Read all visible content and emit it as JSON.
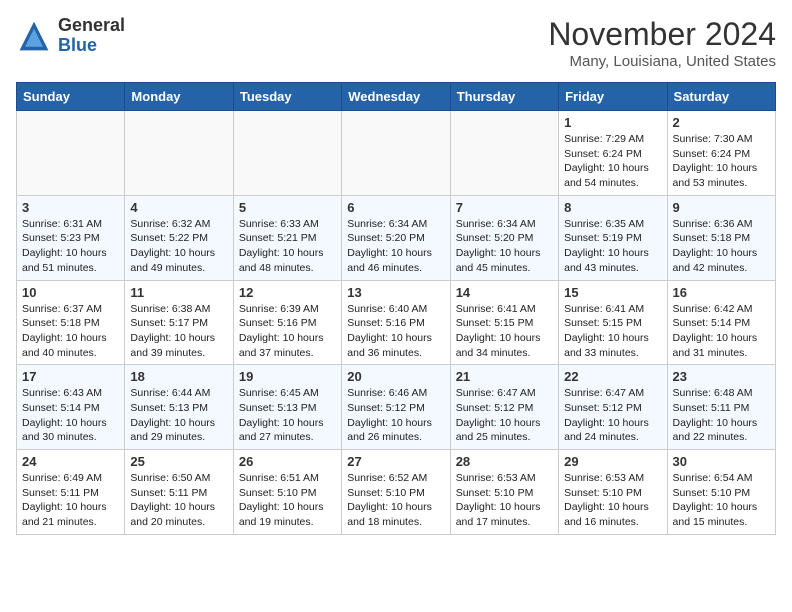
{
  "header": {
    "logo_general": "General",
    "logo_blue": "Blue",
    "month": "November 2024",
    "location": "Many, Louisiana, United States"
  },
  "weekdays": [
    "Sunday",
    "Monday",
    "Tuesday",
    "Wednesday",
    "Thursday",
    "Friday",
    "Saturday"
  ],
  "weeks": [
    [
      {
        "day": "",
        "empty": true
      },
      {
        "day": "",
        "empty": true
      },
      {
        "day": "",
        "empty": true
      },
      {
        "day": "",
        "empty": true
      },
      {
        "day": "",
        "empty": true
      },
      {
        "day": "1",
        "sunrise": "Sunrise: 7:29 AM",
        "sunset": "Sunset: 6:24 PM",
        "daylight": "Daylight: 10 hours and 54 minutes."
      },
      {
        "day": "2",
        "sunrise": "Sunrise: 7:30 AM",
        "sunset": "Sunset: 6:24 PM",
        "daylight": "Daylight: 10 hours and 53 minutes."
      }
    ],
    [
      {
        "day": "3",
        "sunrise": "Sunrise: 6:31 AM",
        "sunset": "Sunset: 5:23 PM",
        "daylight": "Daylight: 10 hours and 51 minutes."
      },
      {
        "day": "4",
        "sunrise": "Sunrise: 6:32 AM",
        "sunset": "Sunset: 5:22 PM",
        "daylight": "Daylight: 10 hours and 49 minutes."
      },
      {
        "day": "5",
        "sunrise": "Sunrise: 6:33 AM",
        "sunset": "Sunset: 5:21 PM",
        "daylight": "Daylight: 10 hours and 48 minutes."
      },
      {
        "day": "6",
        "sunrise": "Sunrise: 6:34 AM",
        "sunset": "Sunset: 5:20 PM",
        "daylight": "Daylight: 10 hours and 46 minutes."
      },
      {
        "day": "7",
        "sunrise": "Sunrise: 6:34 AM",
        "sunset": "Sunset: 5:20 PM",
        "daylight": "Daylight: 10 hours and 45 minutes."
      },
      {
        "day": "8",
        "sunrise": "Sunrise: 6:35 AM",
        "sunset": "Sunset: 5:19 PM",
        "daylight": "Daylight: 10 hours and 43 minutes."
      },
      {
        "day": "9",
        "sunrise": "Sunrise: 6:36 AM",
        "sunset": "Sunset: 5:18 PM",
        "daylight": "Daylight: 10 hours and 42 minutes."
      }
    ],
    [
      {
        "day": "10",
        "sunrise": "Sunrise: 6:37 AM",
        "sunset": "Sunset: 5:18 PM",
        "daylight": "Daylight: 10 hours and 40 minutes."
      },
      {
        "day": "11",
        "sunrise": "Sunrise: 6:38 AM",
        "sunset": "Sunset: 5:17 PM",
        "daylight": "Daylight: 10 hours and 39 minutes."
      },
      {
        "day": "12",
        "sunrise": "Sunrise: 6:39 AM",
        "sunset": "Sunset: 5:16 PM",
        "daylight": "Daylight: 10 hours and 37 minutes."
      },
      {
        "day": "13",
        "sunrise": "Sunrise: 6:40 AM",
        "sunset": "Sunset: 5:16 PM",
        "daylight": "Daylight: 10 hours and 36 minutes."
      },
      {
        "day": "14",
        "sunrise": "Sunrise: 6:41 AM",
        "sunset": "Sunset: 5:15 PM",
        "daylight": "Daylight: 10 hours and 34 minutes."
      },
      {
        "day": "15",
        "sunrise": "Sunrise: 6:41 AM",
        "sunset": "Sunset: 5:15 PM",
        "daylight": "Daylight: 10 hours and 33 minutes."
      },
      {
        "day": "16",
        "sunrise": "Sunrise: 6:42 AM",
        "sunset": "Sunset: 5:14 PM",
        "daylight": "Daylight: 10 hours and 31 minutes."
      }
    ],
    [
      {
        "day": "17",
        "sunrise": "Sunrise: 6:43 AM",
        "sunset": "Sunset: 5:14 PM",
        "daylight": "Daylight: 10 hours and 30 minutes."
      },
      {
        "day": "18",
        "sunrise": "Sunrise: 6:44 AM",
        "sunset": "Sunset: 5:13 PM",
        "daylight": "Daylight: 10 hours and 29 minutes."
      },
      {
        "day": "19",
        "sunrise": "Sunrise: 6:45 AM",
        "sunset": "Sunset: 5:13 PM",
        "daylight": "Daylight: 10 hours and 27 minutes."
      },
      {
        "day": "20",
        "sunrise": "Sunrise: 6:46 AM",
        "sunset": "Sunset: 5:12 PM",
        "daylight": "Daylight: 10 hours and 26 minutes."
      },
      {
        "day": "21",
        "sunrise": "Sunrise: 6:47 AM",
        "sunset": "Sunset: 5:12 PM",
        "daylight": "Daylight: 10 hours and 25 minutes."
      },
      {
        "day": "22",
        "sunrise": "Sunrise: 6:47 AM",
        "sunset": "Sunset: 5:12 PM",
        "daylight": "Daylight: 10 hours and 24 minutes."
      },
      {
        "day": "23",
        "sunrise": "Sunrise: 6:48 AM",
        "sunset": "Sunset: 5:11 PM",
        "daylight": "Daylight: 10 hours and 22 minutes."
      }
    ],
    [
      {
        "day": "24",
        "sunrise": "Sunrise: 6:49 AM",
        "sunset": "Sunset: 5:11 PM",
        "daylight": "Daylight: 10 hours and 21 minutes."
      },
      {
        "day": "25",
        "sunrise": "Sunrise: 6:50 AM",
        "sunset": "Sunset: 5:11 PM",
        "daylight": "Daylight: 10 hours and 20 minutes."
      },
      {
        "day": "26",
        "sunrise": "Sunrise: 6:51 AM",
        "sunset": "Sunset: 5:10 PM",
        "daylight": "Daylight: 10 hours and 19 minutes."
      },
      {
        "day": "27",
        "sunrise": "Sunrise: 6:52 AM",
        "sunset": "Sunset: 5:10 PM",
        "daylight": "Daylight: 10 hours and 18 minutes."
      },
      {
        "day": "28",
        "sunrise": "Sunrise: 6:53 AM",
        "sunset": "Sunset: 5:10 PM",
        "daylight": "Daylight: 10 hours and 17 minutes."
      },
      {
        "day": "29",
        "sunrise": "Sunrise: 6:53 AM",
        "sunset": "Sunset: 5:10 PM",
        "daylight": "Daylight: 10 hours and 16 minutes."
      },
      {
        "day": "30",
        "sunrise": "Sunrise: 6:54 AM",
        "sunset": "Sunset: 5:10 PM",
        "daylight": "Daylight: 10 hours and 15 minutes."
      }
    ]
  ]
}
